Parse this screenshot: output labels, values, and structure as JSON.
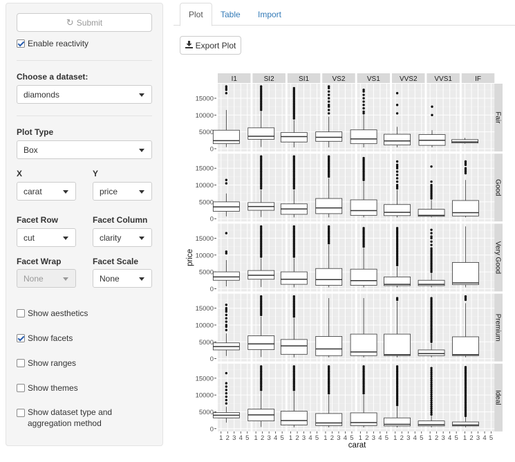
{
  "sidebar": {
    "submit_label": "Submit",
    "enable_reactivity": {
      "label": "Enable reactivity",
      "checked": true
    },
    "dataset": {
      "label": "Choose a dataset:",
      "value": "diamonds"
    },
    "plot_type": {
      "label": "Plot Type",
      "value": "Box"
    },
    "x": {
      "label": "X",
      "value": "carat"
    },
    "y": {
      "label": "Y",
      "value": "price"
    },
    "facet_row": {
      "label": "Facet Row",
      "value": "cut"
    },
    "facet_column": {
      "label": "Facet Column",
      "value": "clarity"
    },
    "facet_wrap": {
      "label": "Facet Wrap",
      "value": "None"
    },
    "facet_scale": {
      "label": "Facet Scale",
      "value": "None"
    },
    "options": [
      {
        "label": "Show aesthetics",
        "checked": false
      },
      {
        "label": "Show facets",
        "checked": true
      },
      {
        "label": "Show ranges",
        "checked": false
      },
      {
        "label": "Show themes",
        "checked": false
      },
      {
        "label": "Show dataset type and aggregation method",
        "checked": false
      }
    ]
  },
  "tabs": [
    {
      "label": "Plot",
      "active": true
    },
    {
      "label": "Table",
      "active": false
    },
    {
      "label": "Import",
      "active": false
    }
  ],
  "export_label": "Export Plot",
  "colors": {
    "panel_bg": "#ebebeb",
    "strip_bg": "#d9d9d9",
    "link": "#337ab7"
  },
  "chart_data": {
    "type": "box",
    "xlabel": "carat",
    "ylabel": "price",
    "ylim": [
      0,
      18500
    ],
    "xlim": [
      0.5,
      5.5
    ],
    "y_ticks": [
      0,
      5000,
      10000,
      15000
    ],
    "x_ticks": [
      1,
      2,
      3,
      4,
      5
    ],
    "columns": [
      "I1",
      "SI2",
      "SI1",
      "VS2",
      "VS1",
      "VVS2",
      "VVS1",
      "IF"
    ],
    "rows": [
      "Fair",
      "Good",
      "Very Good",
      "Premium",
      "Ideal"
    ],
    "boxes": [
      [
        {
          "x": 1.8,
          "q1": 1500,
          "med": 2400,
          "q3": 5500,
          "lo": 500,
          "hi": 11500,
          "out": [
            16500,
            17500,
            18000,
            18500
          ]
        },
        {
          "x": 1.8,
          "q1": 2800,
          "med": 3700,
          "q3": 6200,
          "lo": 500,
          "hi": 11000,
          "out": [
            11500,
            12000,
            12500,
            13000,
            13500,
            14000,
            14500,
            15000,
            15500,
            16000,
            16500,
            17000,
            17500,
            18000,
            18500
          ]
        },
        {
          "x": 1.5,
          "q1": 2000,
          "med": 3600,
          "q3": 4800,
          "lo": 400,
          "hi": 8500,
          "out": [
            9000,
            9500,
            10000,
            10500,
            11000,
            11500,
            12000,
            12500,
            13000,
            13500,
            14000,
            14500,
            15000,
            15500,
            16000,
            16500,
            17000,
            17500,
            18000
          ]
        },
        {
          "x": 1.5,
          "q1": 2200,
          "med": 3400,
          "q3": 5000,
          "lo": 400,
          "hi": 9500,
          "out": [
            10500,
            11500,
            12500,
            13000,
            14000,
            15000,
            16000,
            17000,
            18000,
            18500
          ]
        },
        {
          "x": 1.5,
          "q1": 1500,
          "med": 2900,
          "q3": 5600,
          "lo": 400,
          "hi": 10000,
          "out": [
            10500,
            11000,
            12000,
            13000,
            14000,
            15000,
            16000,
            17000,
            17500
          ]
        },
        {
          "x": 1.3,
          "q1": 1100,
          "med": 2300,
          "q3": 4300,
          "lo": 400,
          "hi": 6500,
          "out": [
            10500,
            13000,
            16500
          ]
        },
        {
          "x": 1.3,
          "q1": 1000,
          "med": 2500,
          "q3": 4200,
          "lo": 400,
          "hi": 5500,
          "out": [
            10000,
            12500
          ]
        },
        {
          "x": 1.0,
          "q1": 1700,
          "med": 2000,
          "q3": 2700,
          "lo": 1500,
          "hi": 3200,
          "out": []
        }
      ],
      [
        {
          "x": 1.8,
          "q1": 2200,
          "med": 3500,
          "q3": 5000,
          "lo": 700,
          "hi": 7500,
          "out": [
            10500,
            11500
          ]
        },
        {
          "x": 1.8,
          "q1": 2500,
          "med": 3600,
          "q3": 4800,
          "lo": 500,
          "hi": 8500,
          "out": [
            9000,
            9500,
            10000,
            10500,
            11000,
            11500,
            12000,
            12500,
            13000,
            13500,
            14000,
            14500,
            15000,
            15500,
            16000,
            16500,
            17000,
            17500,
            18000,
            18500
          ]
        },
        {
          "x": 1.5,
          "q1": 1300,
          "med": 2900,
          "q3": 4400,
          "lo": 400,
          "hi": 8500,
          "out": [
            9000,
            9500,
            10000,
            10500,
            11000,
            11500,
            12000,
            12500,
            13000,
            13500,
            14000,
            14500,
            15000,
            15500,
            16000,
            16500,
            17000,
            17500,
            18000,
            18500
          ]
        },
        {
          "x": 1.5,
          "q1": 1500,
          "med": 3200,
          "q3": 6000,
          "lo": 400,
          "hi": 12000,
          "out": [
            12500,
            13000,
            13500,
            14000,
            14500,
            15000,
            15500,
            16000,
            16500,
            17000,
            17500,
            18000,
            18500
          ]
        },
        {
          "x": 1.5,
          "q1": 1000,
          "med": 2400,
          "q3": 5600,
          "lo": 400,
          "hi": 11000,
          "out": [
            11500,
            12000,
            12500,
            13000,
            13500,
            14000,
            14500,
            15000,
            15500,
            16000,
            16500,
            17000,
            17500,
            18000
          ]
        },
        {
          "x": 1.3,
          "q1": 900,
          "med": 1900,
          "q3": 4200,
          "lo": 400,
          "hi": 8500,
          "out": [
            9000,
            9500,
            10000,
            11000,
            12000,
            13000,
            14000,
            15000,
            15500,
            16000,
            17000
          ]
        },
        {
          "x": 1.2,
          "q1": 700,
          "med": 1000,
          "q3": 2800,
          "lo": 400,
          "hi": 5500,
          "out": [
            6000,
            6500,
            7000,
            7500,
            8000,
            8500,
            9000,
            9500,
            10000,
            11000,
            15500
          ]
        },
        {
          "x": 1.1,
          "q1": 800,
          "med": 1800,
          "q3": 5400,
          "lo": 400,
          "hi": 11500,
          "out": [
            13500,
            14000,
            14500,
            15000,
            16000,
            16500,
            17000
          ]
        }
      ],
      [
        {
          "x": 1.8,
          "q1": 2500,
          "med": 3500,
          "q3": 5000,
          "lo": 700,
          "hi": 8500,
          "out": [
            10500,
            11000,
            16500
          ]
        },
        {
          "x": 1.8,
          "q1": 2800,
          "med": 4000,
          "q3": 5400,
          "lo": 500,
          "hi": 9000,
          "out": [
            9500,
            10000,
            10500,
            11000,
            11500,
            12000,
            12500,
            13000,
            13500,
            14000,
            14500,
            15000,
            15500,
            16000,
            16500,
            17000,
            17500,
            18000,
            18500
          ]
        },
        {
          "x": 1.5,
          "q1": 1300,
          "med": 2800,
          "q3": 5000,
          "lo": 400,
          "hi": 9000,
          "out": [
            9500,
            10000,
            10500,
            11000,
            11500,
            12000,
            12500,
            13000,
            13500,
            14000,
            14500,
            15000,
            15500,
            16000,
            16500,
            17000,
            17500,
            18000,
            18500
          ]
        },
        {
          "x": 1.5,
          "q1": 1000,
          "med": 2700,
          "q3": 6000,
          "lo": 400,
          "hi": 13000,
          "out": [
            13500,
            14000,
            14500,
            15000,
            15500,
            16000,
            16500,
            17000,
            17500,
            18000,
            18500
          ]
        },
        {
          "x": 1.5,
          "q1": 1000,
          "med": 2400,
          "q3": 5800,
          "lo": 400,
          "hi": 12000,
          "out": [
            12500,
            13000,
            13500,
            14000,
            14500,
            15000,
            15500,
            16000,
            16500,
            17000,
            17500,
            18000
          ]
        },
        {
          "x": 1.3,
          "q1": 900,
          "med": 1300,
          "q3": 3500,
          "lo": 400,
          "hi": 6500,
          "out": [
            7000,
            7500,
            8000,
            8500,
            9000,
            9500,
            10000,
            10500,
            11000,
            11500,
            12000,
            12500,
            13000,
            13500,
            14000,
            14500,
            15000,
            15500,
            16000,
            16500,
            17000,
            17500,
            18000
          ]
        },
        {
          "x": 1.2,
          "q1": 900,
          "med": 1300,
          "q3": 2500,
          "lo": 400,
          "hi": 4500,
          "out": [
            5000,
            5500,
            6000,
            6500,
            7000,
            7500,
            8000,
            8500,
            9000,
            9500,
            10000,
            10500,
            11000,
            11500,
            12000,
            13000,
            14000,
            15000,
            15500,
            16500,
            17500
          ]
        },
        {
          "x": 1.1,
          "q1": 1200,
          "med": 1700,
          "q3": 7800,
          "lo": 400,
          "hi": 18500,
          "out": []
        }
      ],
      [
        {
          "x": 1.8,
          "q1": 2600,
          "med": 3600,
          "q3": 4700,
          "lo": 800,
          "hi": 7500,
          "out": [
            8500,
            9500,
            10000,
            11000,
            12000,
            13000,
            14000,
            14500,
            15000,
            16000
          ]
        },
        {
          "x": 1.8,
          "q1": 2700,
          "med": 4400,
          "q3": 6800,
          "lo": 500,
          "hi": 12500,
          "out": [
            13000,
            13500,
            14000,
            14500,
            15000,
            15500,
            16000,
            16500,
            17000,
            17500,
            18000,
            18500
          ]
        },
        {
          "x": 1.5,
          "q1": 1300,
          "med": 3800,
          "q3": 5700,
          "lo": 400,
          "hi": 12000,
          "out": [
            12500,
            13000,
            13500,
            14000,
            14500,
            15000,
            15500,
            16000,
            16500,
            17000,
            17500,
            18000,
            18500
          ]
        },
        {
          "x": 1.5,
          "q1": 900,
          "med": 2900,
          "q3": 6600,
          "lo": 400,
          "hi": 18000,
          "out": []
        },
        {
          "x": 1.5,
          "q1": 900,
          "med": 2000,
          "q3": 7300,
          "lo": 400,
          "hi": 18000,
          "out": []
        },
        {
          "x": 1.3,
          "q1": 900,
          "med": 1200,
          "q3": 7300,
          "lo": 400,
          "hi": 17000,
          "out": [
            17500,
            18000
          ]
        },
        {
          "x": 1.2,
          "q1": 900,
          "med": 1500,
          "q3": 2600,
          "lo": 400,
          "hi": 4500,
          "out": [
            5000,
            5500,
            6000,
            6500,
            7000,
            7500,
            8000,
            8500,
            9000,
            9500,
            10000,
            10500,
            11000,
            11500,
            12000,
            12500,
            13000,
            13500,
            14000,
            14500,
            15000,
            15500,
            16000,
            16500,
            17000,
            17500,
            18000
          ]
        },
        {
          "x": 1.1,
          "q1": 900,
          "med": 1200,
          "q3": 6500,
          "lo": 400,
          "hi": 16500,
          "out": [
            17500,
            18000,
            18500
          ]
        }
      ],
      [
        {
          "x": 1.8,
          "q1": 3200,
          "med": 4000,
          "q3": 4800,
          "lo": 1800,
          "hi": 6500,
          "out": [
            7500,
            8500,
            9500,
            10500,
            11500,
            12500,
            13500,
            16500
          ]
        },
        {
          "x": 1.8,
          "q1": 2300,
          "med": 4100,
          "q3": 5800,
          "lo": 500,
          "hi": 11000,
          "out": [
            11500,
            12000,
            12500,
            13000,
            13500,
            14000,
            14500,
            15000,
            15500,
            16000,
            16500,
            17000,
            17500,
            18000,
            18500
          ]
        },
        {
          "x": 1.5,
          "q1": 1100,
          "med": 2400,
          "q3": 5200,
          "lo": 400,
          "hi": 11000,
          "out": [
            11500,
            12000,
            12500,
            13000,
            13500,
            14000,
            14500,
            15000,
            15500,
            16000,
            16500,
            17000,
            17500,
            18000,
            18500
          ]
        },
        {
          "x": 1.5,
          "q1": 900,
          "med": 1700,
          "q3": 4500,
          "lo": 400,
          "hi": 10000,
          "out": [
            10500,
            11000,
            11500,
            12000,
            12500,
            13000,
            13500,
            14000,
            14500,
            15000,
            15500,
            16000,
            16500,
            17000,
            17500,
            18000,
            18500
          ]
        },
        {
          "x": 1.5,
          "q1": 900,
          "med": 1800,
          "q3": 4700,
          "lo": 400,
          "hi": 10000,
          "out": [
            10500,
            11000,
            11500,
            12000,
            12500,
            13000,
            13500,
            14000,
            14500,
            15000,
            15500,
            16000,
            16500,
            17000,
            17500,
            18000,
            18500
          ]
        },
        {
          "x": 1.3,
          "q1": 800,
          "med": 1300,
          "q3": 3200,
          "lo": 400,
          "hi": 6500,
          "out": [
            7000,
            7500,
            8000,
            8500,
            9000,
            9500,
            10000,
            10500,
            11000,
            11500,
            12000,
            12500,
            13000,
            13500,
            14000,
            14500,
            15000,
            15500,
            16000,
            16500,
            17000,
            17500,
            18000,
            18500
          ]
        },
        {
          "x": 1.2,
          "q1": 800,
          "med": 1200,
          "q3": 2300,
          "lo": 400,
          "hi": 3800,
          "out": [
            4200,
            4800,
            5400,
            6000,
            6600,
            7200,
            7800,
            8400,
            9000,
            9600,
            10200,
            10800,
            11400,
            12000,
            12600,
            13200,
            13800,
            14400,
            15000,
            15600,
            16200,
            16800,
            17400,
            18000
          ]
        },
        {
          "x": 1.1,
          "q1": 800,
          "med": 1100,
          "q3": 2000,
          "lo": 400,
          "hi": 3500,
          "out": [
            3800,
            4300,
            4800,
            5300,
            5800,
            6300,
            6800,
            7300,
            7800,
            8300,
            8800,
            9300,
            9800,
            10300,
            10800,
            11300,
            11800,
            12300,
            12800,
            13300,
            13800,
            14300,
            14800,
            15300,
            15800,
            16300,
            16800,
            17300,
            17800,
            18300
          ]
        }
      ]
    ]
  }
}
